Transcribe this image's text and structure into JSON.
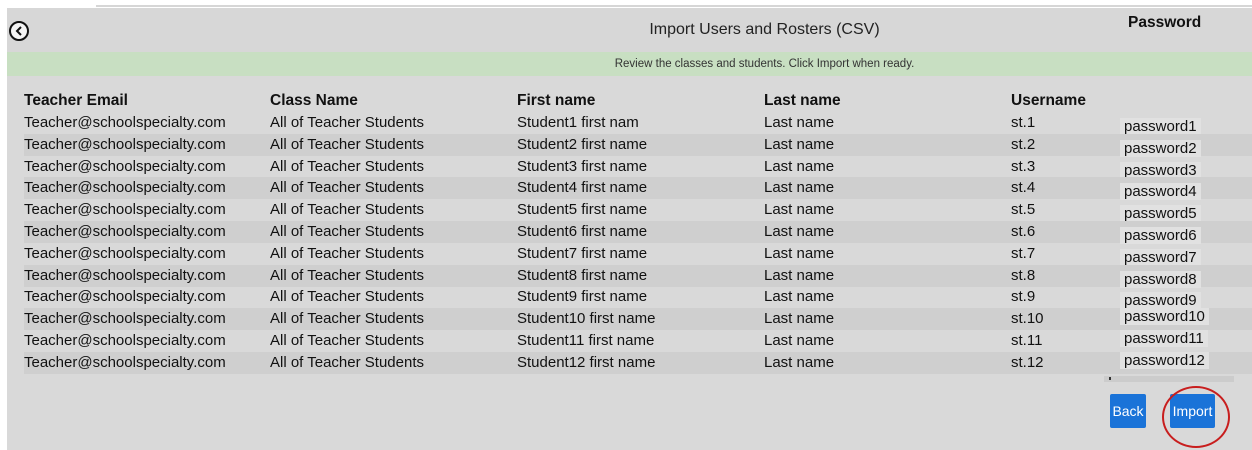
{
  "header": {
    "title": "Import Users and Rosters (CSV)",
    "banner": "Review the classes and students. Click Import when ready."
  },
  "columns": {
    "email": "Teacher Email",
    "class": "Class Name",
    "first": "First name",
    "last": "Last name",
    "username": "Username",
    "password": "Password"
  },
  "rows": [
    {
      "email": "Teacher@schoolspecialty.com",
      "class": "All of Teacher Students",
      "first": "Student1 first nam",
      "last": "Last name",
      "username": "st.1",
      "password": "password1"
    },
    {
      "email": "Teacher@schoolspecialty.com",
      "class": "All of Teacher Students",
      "first": "Student2 first name",
      "last": "Last name",
      "username": "st.2",
      "password": "password2"
    },
    {
      "email": "Teacher@schoolspecialty.com",
      "class": "All of Teacher Students",
      "first": "Student3 first name",
      "last": "Last name",
      "username": "st.3",
      "password": "password3"
    },
    {
      "email": "Teacher@schoolspecialty.com",
      "class": "All of Teacher Students",
      "first": "Student4 first name",
      "last": "Last name",
      "username": "st.4",
      "password": "password4"
    },
    {
      "email": "Teacher@schoolspecialty.com",
      "class": "All of Teacher Students",
      "first": "Student5 first name",
      "last": "Last name",
      "username": "st.5",
      "password": "password5"
    },
    {
      "email": "Teacher@schoolspecialty.com",
      "class": "All of Teacher Students",
      "first": "Student6 first name",
      "last": "Last name",
      "username": "st.6",
      "password": "password6"
    },
    {
      "email": "Teacher@schoolspecialty.com",
      "class": "All of Teacher Students",
      "first": "Student7 first name",
      "last": "Last name",
      "username": "st.7",
      "password": "password7"
    },
    {
      "email": "Teacher@schoolspecialty.com",
      "class": "All of Teacher Students",
      "first": "Student8 first name",
      "last": "Last name",
      "username": "st.8",
      "password": "password8"
    },
    {
      "email": "Teacher@schoolspecialty.com",
      "class": "All of Teacher Students",
      "first": "Student9 first name",
      "last": "Last name",
      "username": "st.9",
      "password": "password9"
    },
    {
      "email": "Teacher@schoolspecialty.com",
      "class": "All of Teacher Students",
      "first": "Student10 first name",
      "last": "Last name",
      "username": "st.10",
      "password": "password10"
    },
    {
      "email": "Teacher@schoolspecialty.com",
      "class": "All of Teacher Students",
      "first": "Student11 first name",
      "last": "Last name",
      "username": "st.11",
      "password": "password11"
    },
    {
      "email": "Teacher@schoolspecialty.com",
      "class": "All of Teacher Students",
      "first": "Student12 first name",
      "last": "Last name",
      "username": "st.12",
      "password": "password12"
    }
  ],
  "buttons": {
    "back": "Back",
    "import": "Import"
  },
  "icons": {
    "back": "chevron-left-icon"
  },
  "colors": {
    "button": "#1a73d8",
    "banner": "#c8dfc2",
    "highlight_ring": "#c81e1e"
  }
}
